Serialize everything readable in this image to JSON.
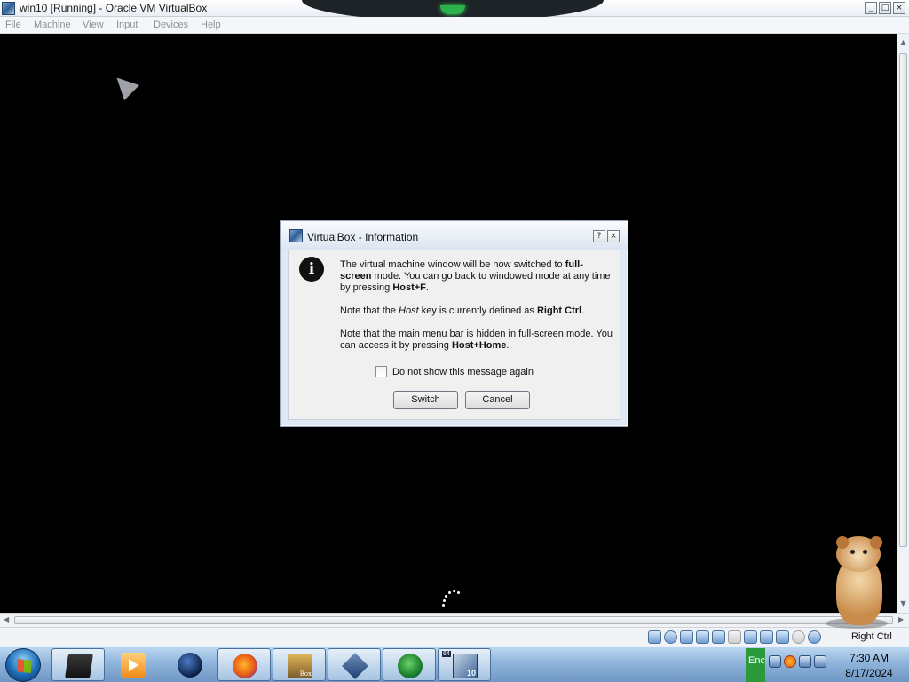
{
  "window": {
    "title": "win10 [Running] - Oracle VM VirtualBox",
    "controls": {
      "minimize": "_",
      "maximize": "□",
      "close": "×"
    }
  },
  "menu": [
    "File",
    "Machine",
    "View",
    "Input",
    "Devices",
    "Help"
  ],
  "dialog": {
    "title": "VirtualBox - Information",
    "help_glyph": "?",
    "close_glyph": "×",
    "icon_glyph": "i",
    "paragraphs": [
      [
        {
          "text": "The virtual machine window will be now switched to ",
          "style": "normal"
        },
        {
          "text": "full-screen",
          "style": "bold"
        },
        {
          "text": " mode. You can go back to windowed mode at any time by pressing ",
          "style": "normal"
        },
        {
          "text": "Host+F",
          "style": "bold"
        },
        {
          "text": ".",
          "style": "normal"
        }
      ],
      [
        {
          "text": "Note that the ",
          "style": "normal"
        },
        {
          "text": "Host",
          "style": "italic"
        },
        {
          "text": " key is currently defined as ",
          "style": "normal"
        },
        {
          "text": "Right Ctrl",
          "style": "bold"
        },
        {
          "text": ".",
          "style": "normal"
        }
      ],
      [
        {
          "text": "Note that the main menu bar is hidden in full-screen mode. You can access it by pressing ",
          "style": "normal"
        },
        {
          "text": "Host+Home",
          "style": "bold"
        },
        {
          "text": ".",
          "style": "normal"
        }
      ]
    ],
    "checkbox": {
      "label": "Do not show this message again",
      "checked": false
    },
    "buttons": {
      "switch": "Switch",
      "cancel": "Cancel"
    }
  },
  "statusbar": {
    "host_key": "Right Ctrl",
    "icons": [
      "hard-disk-icon",
      "optical-drive-icon",
      "audio-icon",
      "network-icon",
      "usb-icon",
      "shared-folders-icon",
      "display-icon",
      "video-capture-icon",
      "cpu-icon",
      "mouse-integration-icon",
      "keyboard-capture-icon"
    ]
  },
  "taskbar": {
    "apps": [
      "trash-app",
      "media-player-app",
      "globe-app",
      "firefox-app",
      "game-app",
      "virtualbox-app",
      "download-manager-app",
      "vm-win10-app"
    ],
    "game_label": "Box",
    "vm_badge": "64",
    "vm_label": "10",
    "language": "Enc",
    "time": "7:30 AM",
    "date": "8/17/2024"
  },
  "colors": {
    "accent": "#2f5d95",
    "vm_background": "#000000",
    "tray_language": "#2a9a3a"
  }
}
